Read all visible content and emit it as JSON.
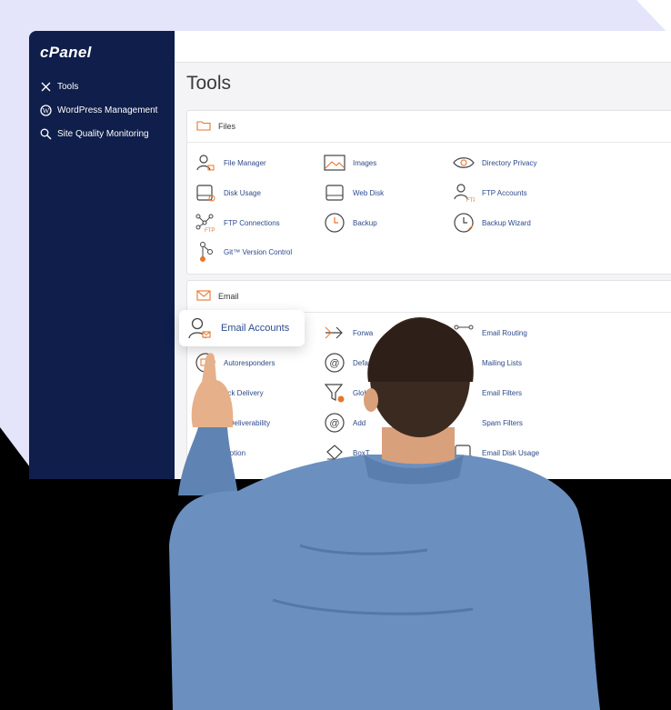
{
  "brand": {
    "logo_text": "cPanel"
  },
  "sidebar": {
    "items": [
      {
        "label": "Tools",
        "icon": "wrench-icon"
      },
      {
        "label": "WordPress Management",
        "icon": "wordpress-icon"
      },
      {
        "label": "Site Quality Monitoring",
        "icon": "magnifier-icon"
      }
    ]
  },
  "main": {
    "title": "Tools",
    "files": {
      "label": "Files",
      "tools": [
        {
          "label": "File Manager",
          "icon": "file-manager-icon"
        },
        {
          "label": "Images",
          "icon": "images-icon"
        },
        {
          "label": "Directory Privacy",
          "icon": "eye-icon"
        },
        {
          "label": "Disk Usage",
          "icon": "disk-icon"
        },
        {
          "label": "Web Disk",
          "icon": "web-disk-icon"
        },
        {
          "label": "FTP Accounts",
          "icon": "ftp-accounts-icon"
        },
        {
          "label": "FTP Connections",
          "icon": "ftp-connections-icon"
        },
        {
          "label": "Backup",
          "icon": "backup-icon"
        },
        {
          "label": "Backup Wizard",
          "icon": "backup-wizard-icon"
        },
        {
          "label": "Git™ Version Control",
          "icon": "git-icon"
        }
      ]
    },
    "email": {
      "label": "Email",
      "tools": [
        {
          "label": "Forwa",
          "icon": "forwarders-icon"
        },
        {
          "label": "Email Routing",
          "icon": "email-routing-icon"
        },
        {
          "label": "Autoresponders",
          "icon": "autoresponders-icon"
        },
        {
          "label": "Defau",
          "icon": "default-address-icon"
        },
        {
          "label": "Mailing Lists",
          "icon": "mailing-lists-icon"
        },
        {
          "label": "ack Delivery",
          "icon": "track-delivery-icon"
        },
        {
          "label": "Glob",
          "icon": "global-filters-icon"
        },
        {
          "label": "Email Filters",
          "icon": "email-filters-icon"
        },
        {
          "label": "il Deliverability",
          "icon": "email-deliverability-icon"
        },
        {
          "label": "Add",
          "icon": "address-importer-icon"
        },
        {
          "label": "Spam Filters",
          "icon": "spam-filters-icon"
        },
        {
          "label": "ryption",
          "icon": "encryption-icon"
        },
        {
          "label": "BoxT",
          "icon": "boxtrapper-icon"
        },
        {
          "label": "Email Disk Usage",
          "icon": "email-disk-usage-icon"
        }
      ]
    },
    "popup": {
      "label": "Email Accounts",
      "icon": "email-accounts-icon"
    }
  },
  "colors": {
    "sidebar": "#0f1e4a",
    "link": "#2d4a8a",
    "accent": "#e8752c",
    "backdrop": "#e4e4fb"
  }
}
